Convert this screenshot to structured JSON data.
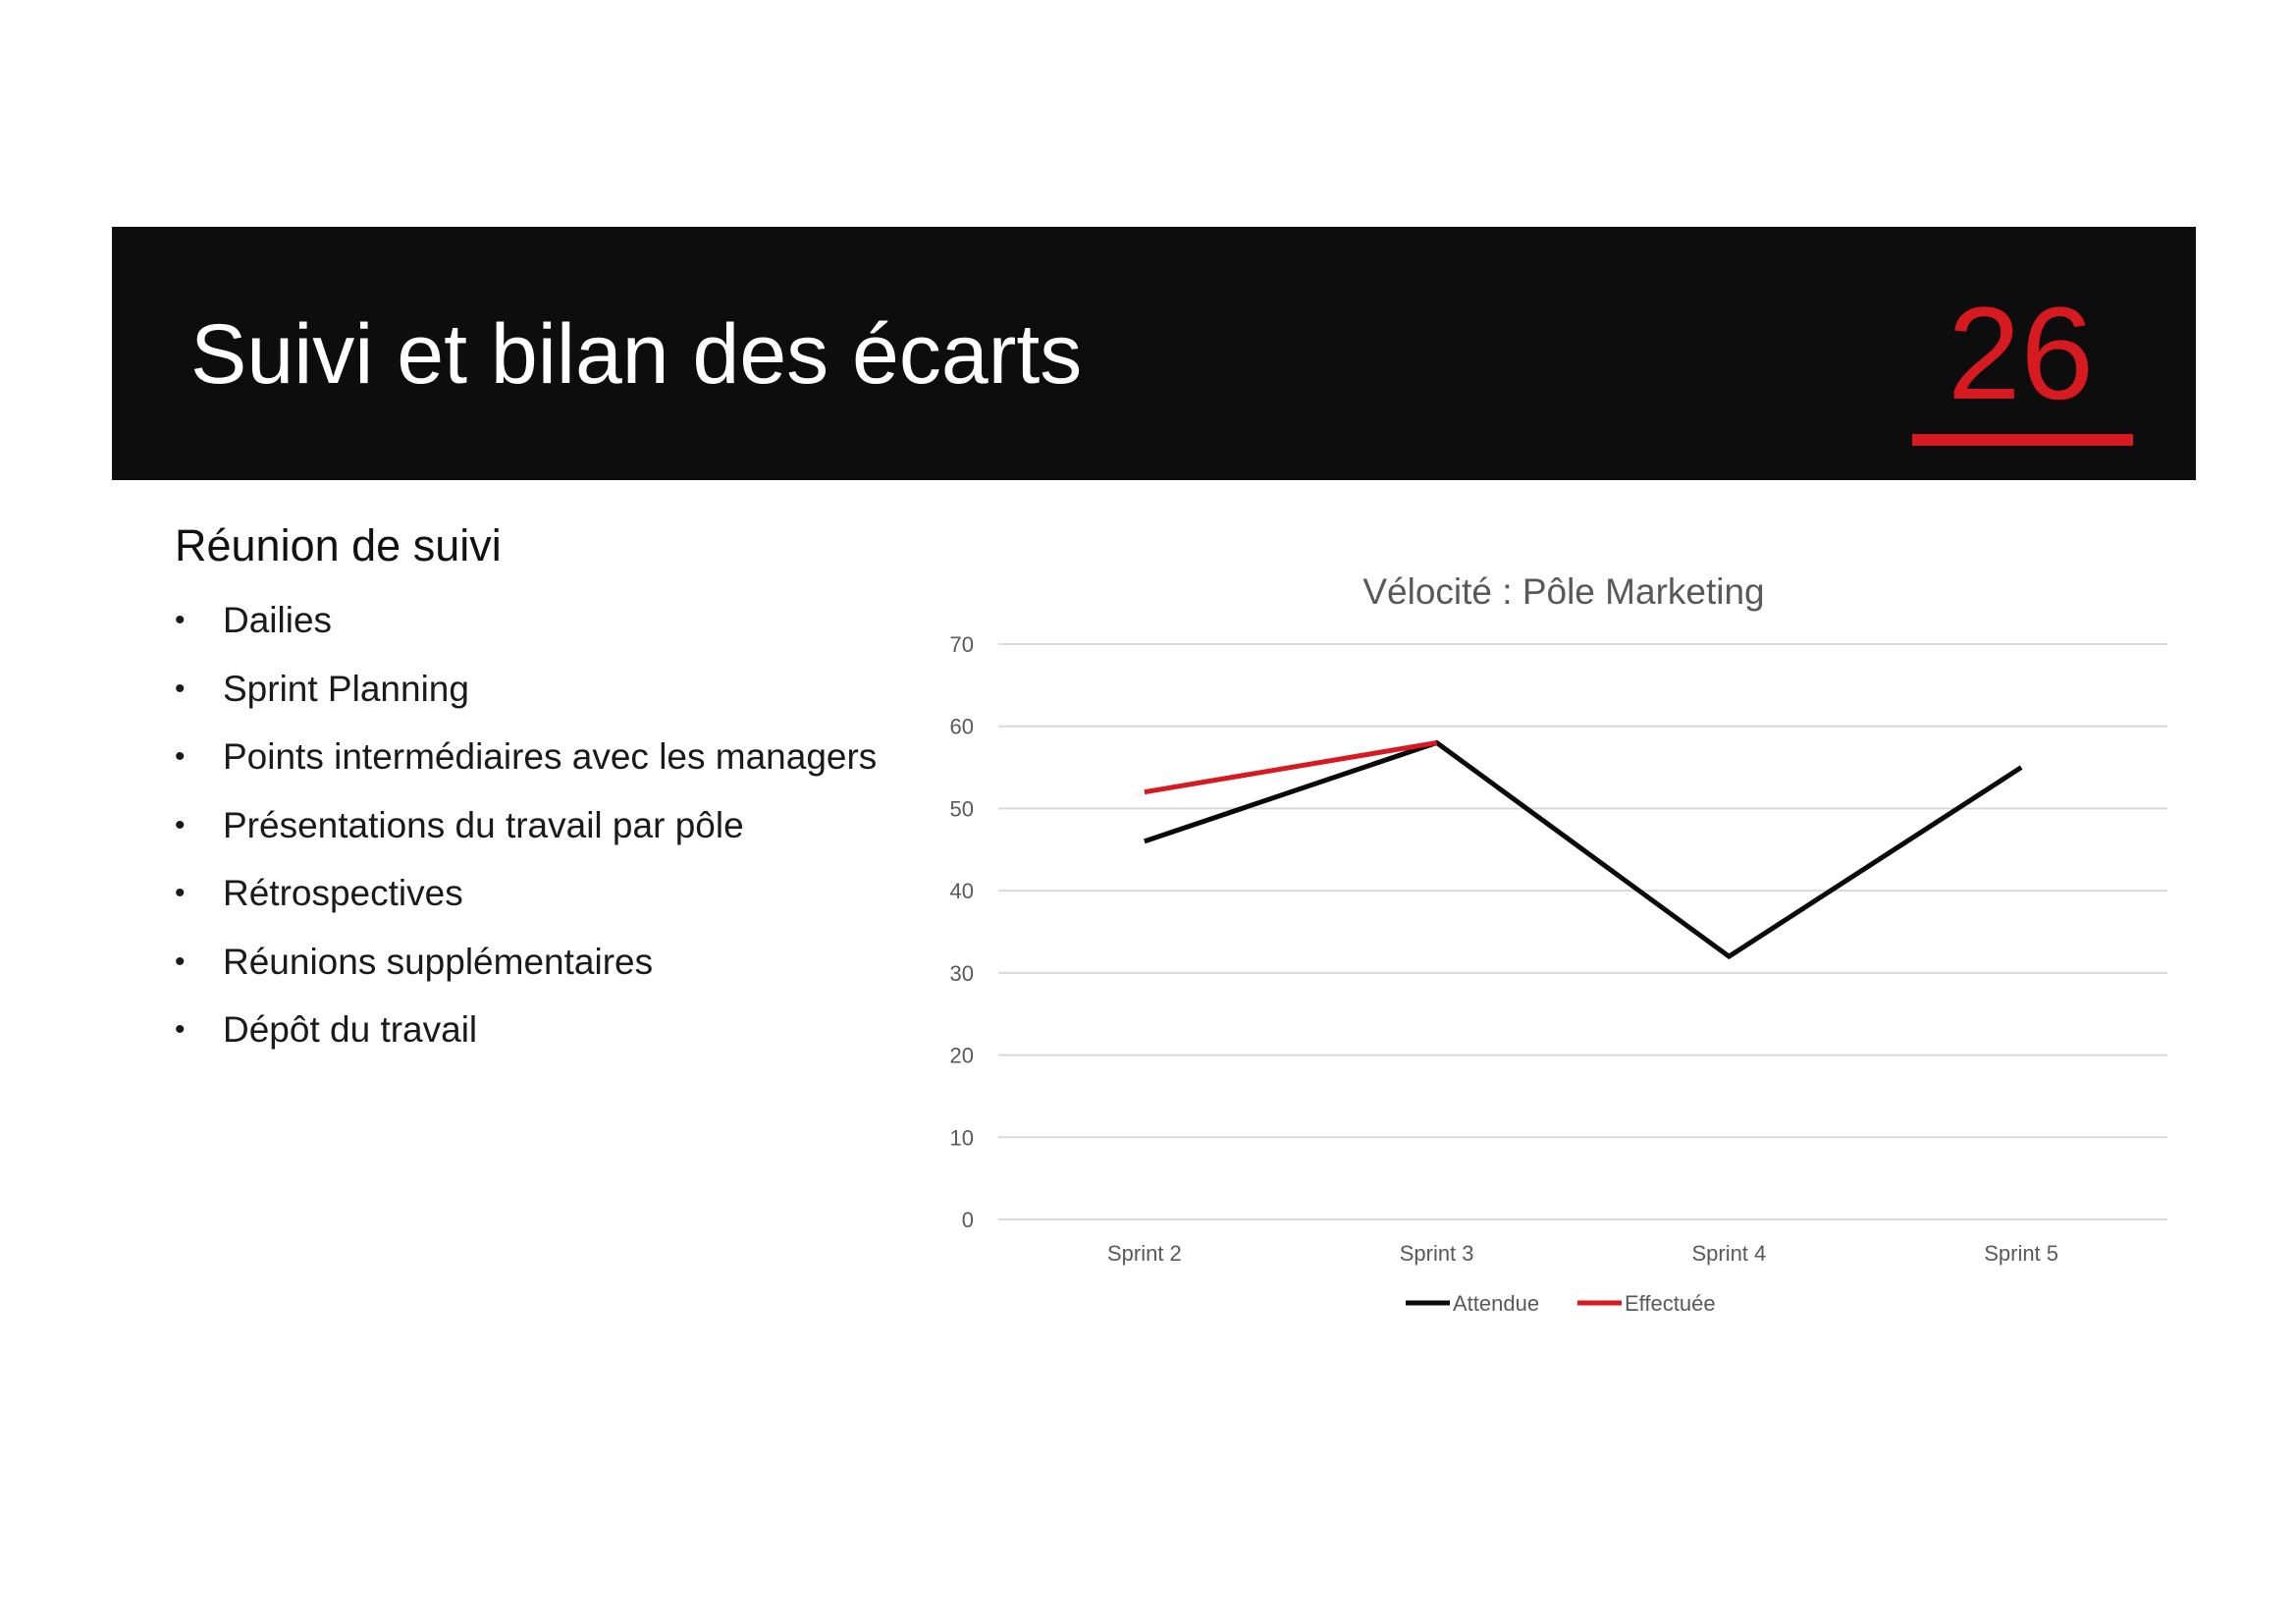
{
  "header": {
    "title": "Suivi et bilan des écarts",
    "page_number": "26"
  },
  "content": {
    "subtitle": "Réunion de suivi",
    "bullets": [
      "Dailies",
      "Sprint Planning",
      "Points intermédiaires avec les managers",
      "Présentations du travail par pôle",
      "Rétrospectives",
      "Réunions supplémentaires",
      "Dépôt du travail"
    ]
  },
  "colors": {
    "header_bg": "#0d0d0d",
    "accent": "#d71920",
    "expected_line": "#0a0a0a",
    "done_line": "#d71920"
  },
  "chart_data": {
    "type": "line",
    "title": "Vélocité : Pôle Marketing",
    "categories": [
      "Sprint 2",
      "Sprint 3",
      "Sprint 4",
      "Sprint 5"
    ],
    "series": [
      {
        "name": "Attendue",
        "values": [
          46,
          58,
          32,
          55
        ],
        "color": "#0a0a0a"
      },
      {
        "name": "Effectuée",
        "values": [
          52,
          58,
          null,
          null
        ],
        "color": "#d71920"
      }
    ],
    "ylim": [
      0,
      70
    ],
    "yticks": [
      0,
      10,
      20,
      30,
      40,
      50,
      60,
      70
    ],
    "grid": true,
    "legend": "bottom"
  }
}
